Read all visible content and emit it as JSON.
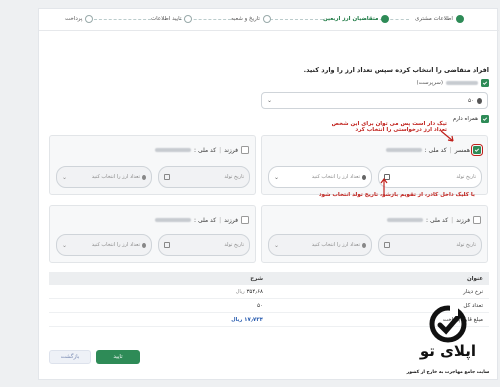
{
  "steps": [
    {
      "label": "اطلاعات مشتری",
      "state": "done"
    },
    {
      "label": "متقاضیان ارز اربعین",
      "state": "active"
    },
    {
      "label": "تاریخ و شعبه",
      "state": "pending"
    },
    {
      "label": "تایید اطلاعات",
      "state": "pending"
    },
    {
      "label": "پرداخت",
      "state": "pending"
    }
  ],
  "instruction": "افراد متقاضی را انتخاب کرده سپس تعداد ارز را وارد کنید.",
  "primary_applicant": {
    "suffix": "(سرپرست)",
    "amount_value": "۵۰"
  },
  "companions_label": "همراه دارم",
  "companion_cards": [
    {
      "relation": "همسر",
      "national_id_label": "کد ملی :",
      "date_placeholder": "تاریخ تولد",
      "currency_placeholder": "تعداد ارز را انتخاب کنید"
    },
    {
      "relation": "فرزند",
      "national_id_label": "کد ملی :",
      "date_placeholder": "تاریخ تولد",
      "currency_placeholder": "تعداد ارز را انتخاب کنید"
    },
    {
      "relation": "فرزند",
      "national_id_label": "کد ملی :",
      "date_placeholder": "تاریخ تولد",
      "currency_placeholder": "تعداد ارز را انتخاب کنید"
    },
    {
      "relation": "فرزند",
      "national_id_label": "کد ملی :",
      "date_placeholder": "تاریخ تولد",
      "currency_placeholder": "تعداد ارز را انتخاب کنید"
    }
  ],
  "annotations": {
    "tick_note_line1": "تیک دار است پس می توان برای این شخص",
    "tick_note_line2": "تعداد ارز درخواستی را انتخاب کرد",
    "date_note": "با کلیک داخل کادر، از تقویم بازشو، تاریخ تولد انتخاب شود"
  },
  "summary": {
    "headers": [
      "عنوان",
      "شرح"
    ],
    "rows": [
      {
        "title": "نرخ دینار",
        "value": "۳۵۴٫۶۸",
        "unit": "ریال"
      },
      {
        "title": "تعداد کل",
        "value": "۵۰",
        "unit": ""
      },
      {
        "title": "مبلغ قابل پرداخت",
        "value": "۱۷٫۷۳۴",
        "unit": "ریال"
      }
    ]
  },
  "buttons": {
    "confirm": "تایید",
    "back": "بازگشت"
  },
  "watermark": {
    "brand": "اپلای تو",
    "tagline": "سایت جامع مهاجرت به خارج از کشور"
  },
  "colors": {
    "accent": "#2e8b57",
    "annotation": "#c0201b",
    "link_blue": "#2a5db0"
  }
}
